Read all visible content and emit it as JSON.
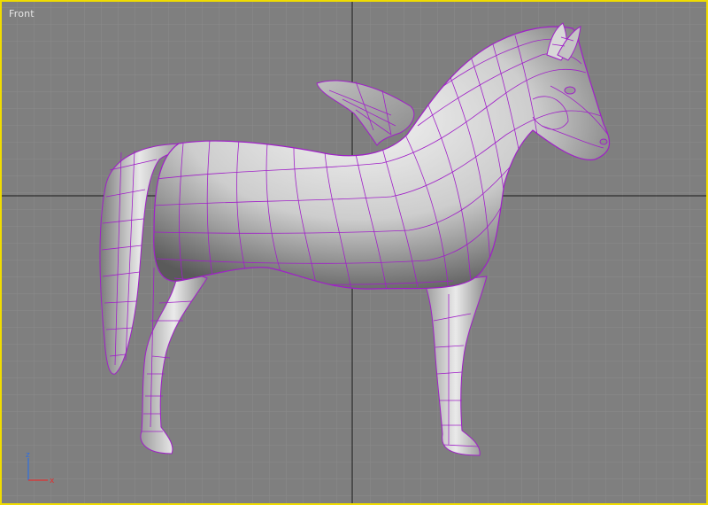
{
  "viewport": {
    "label": "Front",
    "border_color": "#f0dc00",
    "background_color": "#7f7f7f",
    "grid_color": "#8c8c8c",
    "axis_line_color": "#1a1a1a"
  },
  "model": {
    "name": "pegasus-horse-mesh",
    "surface_color": "#cfcfcf",
    "wireframe_color": "#a020c8"
  },
  "axis_gizmo": {
    "z_label": "z",
    "x_label": "x",
    "z_color": "#2f6fe0",
    "x_color": "#e03030"
  }
}
